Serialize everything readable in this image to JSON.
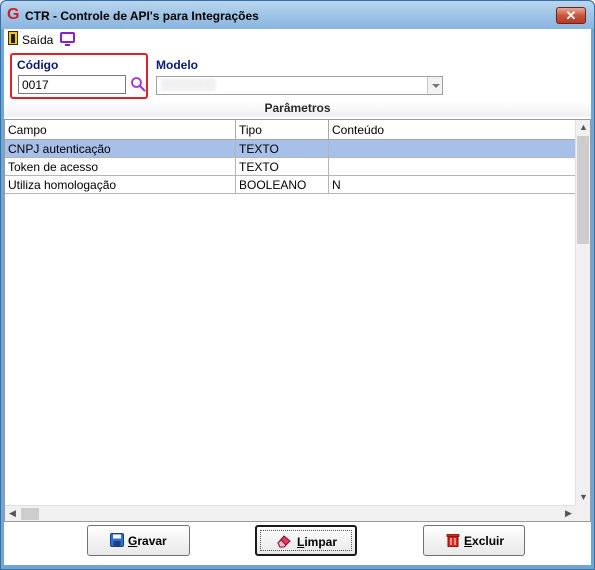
{
  "window": {
    "title": "CTR - Controle de API's para Integrações",
    "close_glyph": "✕",
    "app_icon": "G"
  },
  "toolbar": {
    "exit_label": "Saída",
    "exit_icon": "door-exit-icon",
    "monitor_icon": "monitor-icon"
  },
  "codigo": {
    "label": "Código",
    "value": "0017",
    "search_icon": "magnifier-icon"
  },
  "modelo": {
    "label": "Modelo",
    "value": "▒▒▒▒▒▒▒"
  },
  "parametros": {
    "title": "Parâmetros",
    "columns": [
      "Campo",
      "Tipo",
      "Conteúdo"
    ],
    "rows": [
      {
        "campo": "CNPJ autenticação",
        "tipo": "TEXTO",
        "conteudo": "",
        "selected": true
      },
      {
        "campo": "Token de acesso",
        "tipo": "TEXTO",
        "conteudo": "",
        "selected": false
      },
      {
        "campo": "Utiliza homologação",
        "tipo": "BOOLEANO",
        "conteudo": "N",
        "selected": false
      }
    ]
  },
  "buttons": {
    "gravar": {
      "prefix": "",
      "underlined": "G",
      "rest": "ravar",
      "icon": "save-icon"
    },
    "limpar": {
      "prefix": "",
      "underlined": "L",
      "rest": "impar",
      "icon": "eraser-icon"
    },
    "excluir": {
      "prefix": "",
      "underlined": "E",
      "rest": "xcluir",
      "icon": "trash-icon"
    }
  },
  "colors": {
    "selected_row": "#a7c0ea",
    "label_blue": "#0a1a70",
    "highlight_red": "#e0202a"
  }
}
